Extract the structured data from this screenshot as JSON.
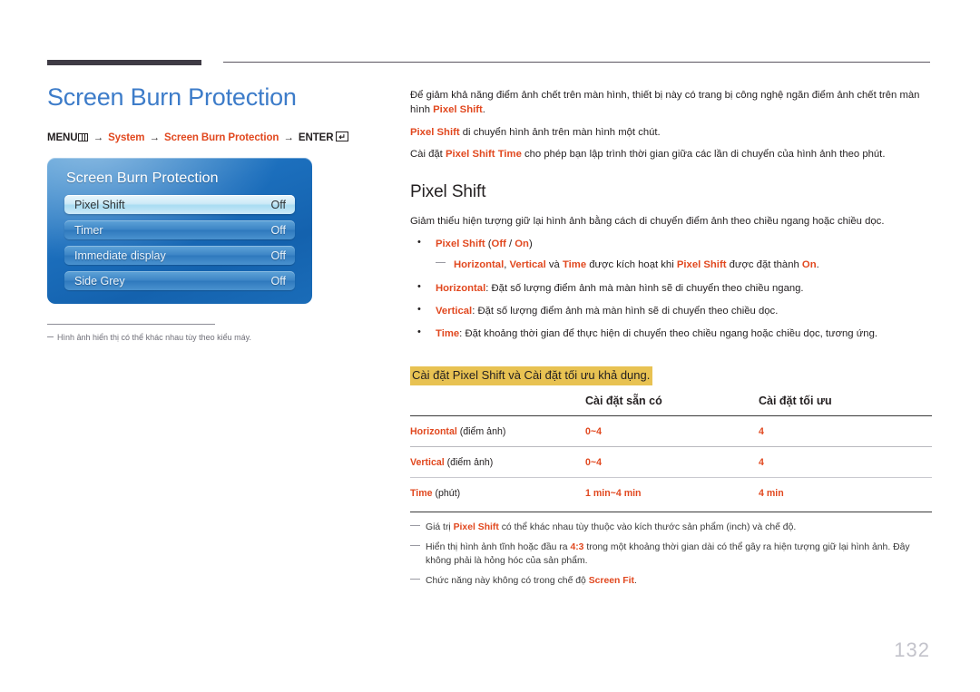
{
  "header": {
    "rule_color": "#3f3b45"
  },
  "left": {
    "page_title": "Screen Burn Protection",
    "menu_path": {
      "menu_label": "MENU",
      "menu_icon": "menu-bars-icon",
      "arrow": "→",
      "step1": "System",
      "step2": "Screen Burn Protection",
      "enter_label": "ENTER",
      "enter_icon": "enter-return-icon",
      "enter_glyph": "↵"
    },
    "osd": {
      "title": "Screen Burn Protection",
      "rows": [
        {
          "label": "Pixel Shift",
          "value": "Off",
          "selected": true
        },
        {
          "label": "Timer",
          "value": "Off",
          "selected": false
        },
        {
          "label": "Immediate display",
          "value": "Off",
          "selected": false
        },
        {
          "label": "Side Grey",
          "value": "Off",
          "selected": false
        }
      ]
    },
    "note": "Hình ảnh hiển thị có thể khác nhau tùy theo kiểu máy."
  },
  "right": {
    "intro": {
      "p1_a": "Để giảm khả năng điểm ảnh chết trên màn hình, thiết bị này có trang bị công nghệ ngăn điểm ảnh chết trên màn hình ",
      "p1_b": "Pixel Shift",
      "p1_c": ".",
      "p2_a": "Pixel Shift",
      "p2_b": " di chuyển hình ảnh trên màn hình một chút.",
      "p3_a": "Cài đặt ",
      "p3_b": "Pixel Shift Time",
      "p3_c": " cho phép bạn lập trình thời gian giữa các lần di chuyển của hình ảnh theo phút."
    },
    "section_title": "Pixel Shift",
    "section_desc": "Giảm thiểu hiện tượng giữ lại hình ảnh bằng cách di chuyển điểm ảnh theo chiều ngang hoặc chiều dọc.",
    "bullets": [
      {
        "term": "Pixel Shift",
        "rest_pre": " (",
        "opt1": "Off",
        "sep": " / ",
        "opt2": "On",
        "rest_post": ")",
        "subnote": {
          "t1": "Horizontal",
          "s1": ", ",
          "t2": "Vertical",
          "s2": " và ",
          "t3": "Time",
          "s3": " được kích hoạt khi ",
          "t4": "Pixel Shift",
          "s4": " được đặt thành ",
          "t5": "On",
          "s5": "."
        }
      },
      {
        "term": "Horizontal",
        "text": ": Đặt số lượng điểm ảnh mà màn hình sẽ di chuyển theo chiều ngang."
      },
      {
        "term": "Vertical",
        "text": ": Đặt số lượng điểm ảnh mà màn hình sẽ di chuyển theo chiều dọc."
      },
      {
        "term": "Time",
        "text": ": Đặt khoảng thời gian để thực hiện di chuyển theo chiều ngang hoặc chiều dọc, tương ứng."
      }
    ],
    "table": {
      "caption": "Cài đặt Pixel Shift và Cài đặt tối ưu khả dụng.",
      "caption_highlight_color": "#e8c252",
      "headers": [
        "",
        "Cài đặt sẵn có",
        "Cài đặt tối ưu"
      ],
      "rows": [
        {
          "name_term": "Horizontal",
          "name_unit": " (điểm ảnh)",
          "available": "0~4",
          "optimum": "4"
        },
        {
          "name_term": "Vertical",
          "name_unit": " (điểm ảnh)",
          "available": "0~4",
          "optimum": "4"
        },
        {
          "name_term": "Time",
          "name_unit": " (phút)",
          "available": "1 min~4 min",
          "optimum": "4 min"
        }
      ]
    },
    "footnotes": [
      {
        "a": "Giá trị ",
        "t": "Pixel Shift",
        "b": " có thể khác nhau tùy thuộc vào kích thước sản phẩm (inch) và chế độ."
      },
      {
        "a": "Hiển thị hình ảnh tĩnh hoặc đầu ra ",
        "t": "4:3",
        "b": " trong một khoảng thời gian dài có thể gây ra hiện tượng giữ lại hình ảnh. Đây không phải là hỏng hóc của sản phẩm."
      },
      {
        "a": "Chức năng này không có trong chế độ ",
        "t": "Screen Fit",
        "b": "."
      }
    ]
  },
  "page_number": "132",
  "colors": {
    "accent_orange": "#e1481f",
    "title_blue": "#3d7cc9",
    "highlight_yellow": "#e8c252",
    "page_number_gray": "#c3c3cb"
  }
}
